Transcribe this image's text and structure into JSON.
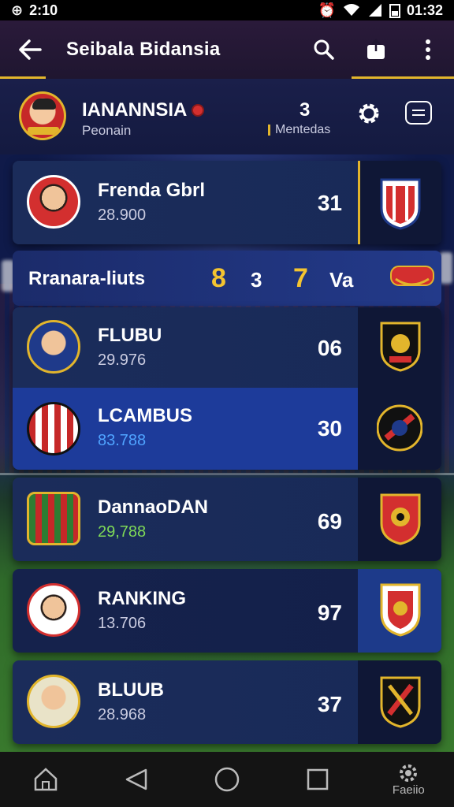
{
  "status": {
    "time_left": "2:10",
    "time_right": "01:32"
  },
  "appbar": {
    "title": "Seibala Bidansia"
  },
  "header": {
    "name": "IANANNSIA",
    "subtitle": "Peonain",
    "count": "3",
    "count_label": "Mentedas"
  },
  "featured": {
    "name": "Frenda Gbrl",
    "value": "28.900",
    "score": "31"
  },
  "ranking_strip": {
    "label": "Rranara-liuts",
    "n1": "8",
    "n2": "3",
    "n3": "7",
    "n4": "Va"
  },
  "rows": [
    {
      "name": "FLUBU",
      "value": "29.976",
      "score": "06"
    },
    {
      "name": "LCAMBUS",
      "value": "83.788",
      "score": "30"
    },
    {
      "name": "DannaoDAN",
      "value": "29,788",
      "score": "69"
    },
    {
      "name": "RANKING",
      "value": "13.706",
      "score": "97"
    },
    {
      "name": "BLUUB",
      "value": "28.968",
      "score": "37"
    }
  ],
  "navbar": {
    "profile_label": "Faeiio"
  },
  "colors": {
    "accent": "#e2b52c",
    "highlight_value": "#4fa3ff",
    "green_value": "#7ed957"
  }
}
